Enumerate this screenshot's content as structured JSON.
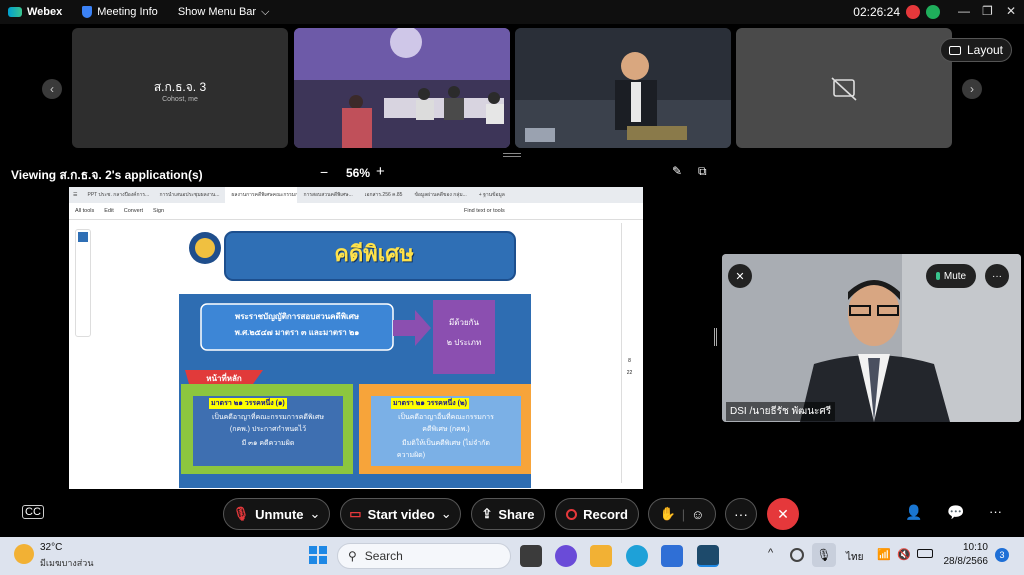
{
  "topbar": {
    "app_name": "Webex",
    "meeting_info": "Meeting Info",
    "show_menu_bar": "Show Menu Bar",
    "time": "02:26:24",
    "chevron": "⌵"
  },
  "filmstrip": {
    "tile1_name": "ส.ก.ธ.จ. 3",
    "tile1_sub": "Cohost, me",
    "layout_label": "Layout",
    "prev_glyph": "‹",
    "next_glyph": "›"
  },
  "viewing": {
    "label": "Viewing ส.ก.ธ.จ. 2's application(s)",
    "zoom": "56%",
    "minus": "−",
    "plus": "+"
  },
  "browser": {
    "tabs": [
      "PPT ประช. กลางปีองค์การ...",
      "การนำเสนอประชุมผลงาน...",
      "ผลงานการคดีพิเศษคณะกรรมการ...",
      "การสอบสวนคดีพิเศษ...",
      "เอกสาร.256 ค.85",
      "ข้อมูลผ่านคดีของ กลุ่ม...",
      "+ ฐานข้อมูล"
    ],
    "toolbar": [
      "All tools",
      "Edit",
      "Convert",
      "Sign"
    ],
    "find": "Find text or tools",
    "page_num": "8",
    "page_total": "22"
  },
  "slide": {
    "title": "คดีพิเศษ",
    "act_line1": "พระราชบัญญัติการสอบสวนคดีพิเศษ",
    "act_line2": "พ.ศ.๒๕๔๗ มาตรา ๓ และมาตรา ๒๑",
    "types_line1": "มีด้วยกัน",
    "types_line2": "๒ ประเภท",
    "main_duty": "หน้าที่หลัก",
    "box1_title": "มาตรา ๒๑ วรรคหนึ่ง (๑)",
    "box1_l1": "เป็นคดีอาญาที่คณะกรรมการคดีพิเศษ",
    "box1_l2": "(กคพ.) ประกาศกำหนดไว้",
    "box1_l3": "มี ๓๑ คดีความผิด",
    "box2_title": "มาตรา ๒๑ วรรคหนึ่ง (๒)",
    "box2_l1": "เป็นคดีอาญาอื่นที่คณะกรรมการ",
    "box2_l2": "คดีพิเศษ (กคพ.)",
    "box2_l3": "มีมติให้เป็นคดีพิเศษ (ไม่จำกัด",
    "box2_l4": "ความผิด)"
  },
  "video": {
    "name": "DSI /นายธีรัช พัฒนะศรี",
    "mute_label": "Mute",
    "more": "···"
  },
  "controls": {
    "unmute": "Unmute",
    "start_video": "Start video",
    "share": "Share",
    "record": "Record",
    "more": "···",
    "end": "✕"
  },
  "taskbar": {
    "temp": "32°C",
    "weather": "มีเมฆบางส่วน",
    "search": "Search",
    "lang": "ไทย",
    "time": "10:10",
    "date": "28/8/2566",
    "notif": "3"
  },
  "colors": {
    "accent_red": "#e5383b",
    "slide_blue": "#2f6fb5",
    "slide_purple": "#8b4fb0",
    "slide_green": "#8cc63f",
    "slide_orange": "#f7a43a"
  }
}
